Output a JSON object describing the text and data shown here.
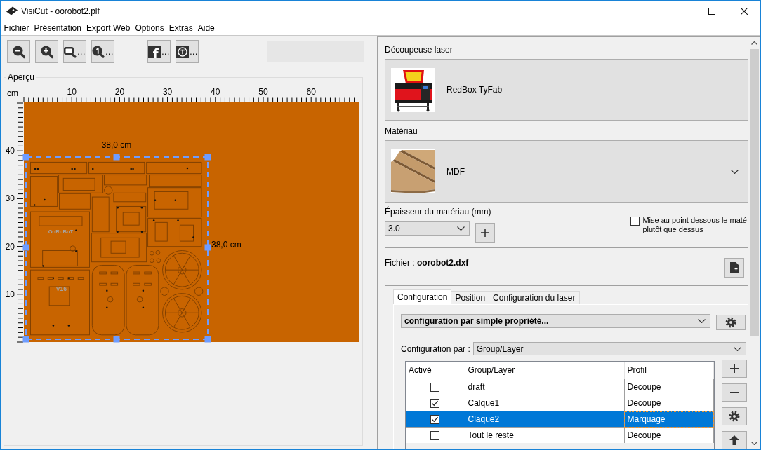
{
  "window": {
    "title": "VisiCut - oorobot2.plf"
  },
  "menu": [
    "Fichier",
    "Présentation",
    "Export Web",
    "Options",
    "Extras",
    "Aide"
  ],
  "toolbar": {
    "view_buttons": [
      {
        "kind": "zoom-out"
      },
      {
        "kind": "zoom-in"
      },
      {
        "kind": "zoom-window",
        "label": "..."
      },
      {
        "kind": "zoom-one",
        "label": "..."
      }
    ],
    "export_buttons": [
      {
        "kind": "letter-f",
        "label": "..."
      },
      {
        "kind": "letter-t",
        "label": "..."
      }
    ]
  },
  "preview": {
    "title": "Aperçu",
    "unit": "cm",
    "x_labels": [
      "10",
      "20",
      "30",
      "40",
      "50",
      "60"
    ],
    "y_labels": [
      "40",
      "30",
      "20",
      "10"
    ],
    "selection": {
      "width": "38,0 cm",
      "height": "38,0 cm"
    },
    "engravings": [
      "OoRoBoT",
      "V16"
    ]
  },
  "laser_cutter": {
    "label": "Découpeuse laser",
    "name": "RedBox TyFab"
  },
  "material": {
    "label": "Matériau",
    "name": "MDF"
  },
  "thickness": {
    "label": "Épaisseur du matériau (mm)",
    "value": "3.0"
  },
  "focus_option": {
    "lines": [
      "Mise au point dessous le maté",
      "plutôt que dessus"
    ],
    "checked": false
  },
  "file": {
    "text": "Fichier : **oorobot2.dxf**"
  },
  "tabs": [
    {
      "label": "Configuration",
      "selected": true
    },
    {
      "label": "Position",
      "selected": false
    },
    {
      "label": "Configuration du laser",
      "selected": false
    }
  ],
  "mapping": {
    "preset": "configuration par simple propriété...",
    "by_label": "Configuration par :",
    "by_value": "Group/Layer"
  },
  "table": {
    "columns": [
      "Activé",
      "Group/Layer",
      "Profil"
    ],
    "rows": [
      {
        "checked": false,
        "layer": "draft",
        "profile": "Decoupe",
        "selected": false
      },
      {
        "checked": true,
        "layer": "Calque1",
        "profile": "Decoupe",
        "selected": false
      },
      {
        "checked": true,
        "layer": "Claque2",
        "profile": "Marquage",
        "selected": true
      },
      {
        "checked": false,
        "layer": "Tout le reste",
        "profile": "Decoupe",
        "selected": false
      }
    ]
  },
  "side_buttons": [
    {
      "kind": "add"
    },
    {
      "kind": "remove"
    },
    {
      "kind": "settings"
    },
    {
      "kind": "move-up"
    }
  ]
}
